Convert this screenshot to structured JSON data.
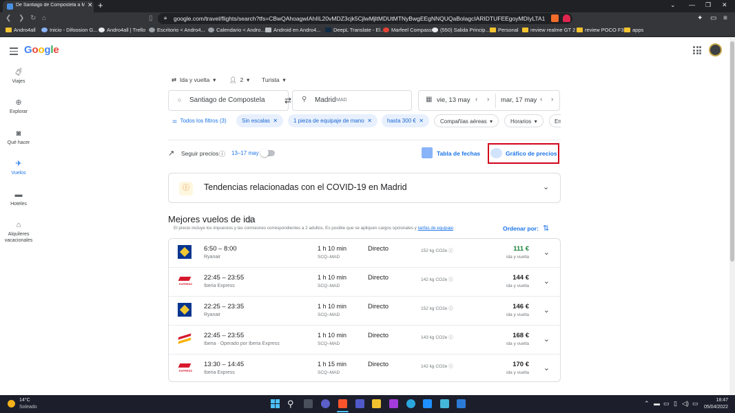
{
  "browser": {
    "tab_title": "De Santiago de Compostela a M...",
    "url": "google.com/travel/flights/search?tfs=CBwQAhoagwIAhIIL20vMDZ3cjk5CjlwMjltMDUtMTNyBwgEEgNNQUQaBolagcIARIDTUFEEgoyMDIyLTA1LTE3cgwIAh..."
  },
  "bookmarks": [
    "Andro4all",
    "Inicio - Difoosion G...",
    "Andro4all | Trello",
    "Escritorio < Andro4...",
    "Calendario < Andro...",
    "Android en Andro4...",
    "DeepL Translate - El...",
    "Marfeel Compass",
    "(550) Salida Princip...",
    "Personal",
    "review realme GT 2",
    "review POCO F3",
    "apps"
  ],
  "logo": {
    "g1": "G",
    "o1": "o",
    "o2": "o",
    "g2": "g",
    "l": "l",
    "e": "e"
  },
  "side_nav": [
    {
      "label": "Viajes",
      "icon": "luggage-icon"
    },
    {
      "label": "Explorar",
      "icon": "explore-icon"
    },
    {
      "label": "Qué hacer",
      "icon": "camera-icon"
    },
    {
      "label": "Vuelos",
      "icon": "plane-icon"
    },
    {
      "label": "Hoteles",
      "icon": "bed-icon"
    },
    {
      "label": "Alquileres vacacionales",
      "icon": "house-icon"
    }
  ],
  "search": {
    "trip_type": "Ida y vuelta",
    "passengers": "2",
    "cabin": "Turista",
    "origin": "Santiago de Compostela",
    "destination": "Madrid",
    "destination_code": "MAD",
    "depart": "vie, 13 may",
    "return": "mar, 17 may"
  },
  "filters": {
    "all": "Todos los filtros (3)",
    "chips_selected": [
      "Sin escalas",
      "1 pieza de equipaje de mano",
      "hasta 300 €"
    ],
    "chips_plain": [
      "Compañías aéreas",
      "Horarios",
      "En"
    ]
  },
  "tracking": {
    "label": "Seguir precios",
    "dates": "13–17 may",
    "date_grid": "Tabla de fechas",
    "price_graph": "Gráfico de precios"
  },
  "covid": {
    "title": "Tendencias relacionadas con el COVID-19 en Madrid"
  },
  "results": {
    "heading": "Mejores vuelos de ida",
    "note": "El precio incluye los impuestos y las comisiones correspondientes a 2 adultos. Es posible que se apliquen cargos opcionales y",
    "note_link": "tarifas de equipaje",
    "note_end": ".",
    "sort_label": "Ordenar por:",
    "flights": [
      {
        "time": "6:50 – 8:00",
        "airline": "Ryanair",
        "duration": "1 h 10 min",
        "route": "SCQ–MAD",
        "stops": "Directo",
        "co2": "152 kg CO2e",
        "price": "111 €",
        "trip": "ida y vuelta",
        "logo": "ryanair"
      },
      {
        "time": "22:45 – 23:55",
        "airline": "Iberia Express",
        "duration": "1 h 10 min",
        "route": "SCQ–MAD",
        "stops": "Directo",
        "co2": "142 kg CO2e",
        "price": "144 €",
        "trip": "ida y vuelta",
        "logo": "express"
      },
      {
        "time": "22:25 – 23:35",
        "airline": "Ryanair",
        "duration": "1 h 10 min",
        "route": "SCQ–MAD",
        "stops": "Directo",
        "co2": "152 kg CO2e",
        "price": "146 €",
        "trip": "ida y vuelta",
        "logo": "ryanair"
      },
      {
        "time": "22:45 – 23:55",
        "airline": "Iberia · Operado por Iberia Express",
        "duration": "1 h 10 min",
        "route": "SCQ–MAD",
        "stops": "Directo",
        "co2": "143 kg CO2e",
        "price": "168 €",
        "trip": "ida y vuelta",
        "logo": "iberia"
      },
      {
        "time": "13:30 – 14:45",
        "airline": "Iberia Express",
        "duration": "1 h 15 min",
        "route": "SCQ–MAD",
        "stops": "Directo",
        "co2": "142 kg CO2e",
        "price": "170 €",
        "trip": "ida y vuelta",
        "logo": "express"
      }
    ]
  },
  "taskbar": {
    "weather_temp": "14°C",
    "weather_desc": "Soleado",
    "time": "18:47",
    "date": "05/04/2022"
  },
  "colors": {
    "accent": "#1a73e8",
    "best_price": "#188038",
    "highlight_border": "#d0021b"
  }
}
